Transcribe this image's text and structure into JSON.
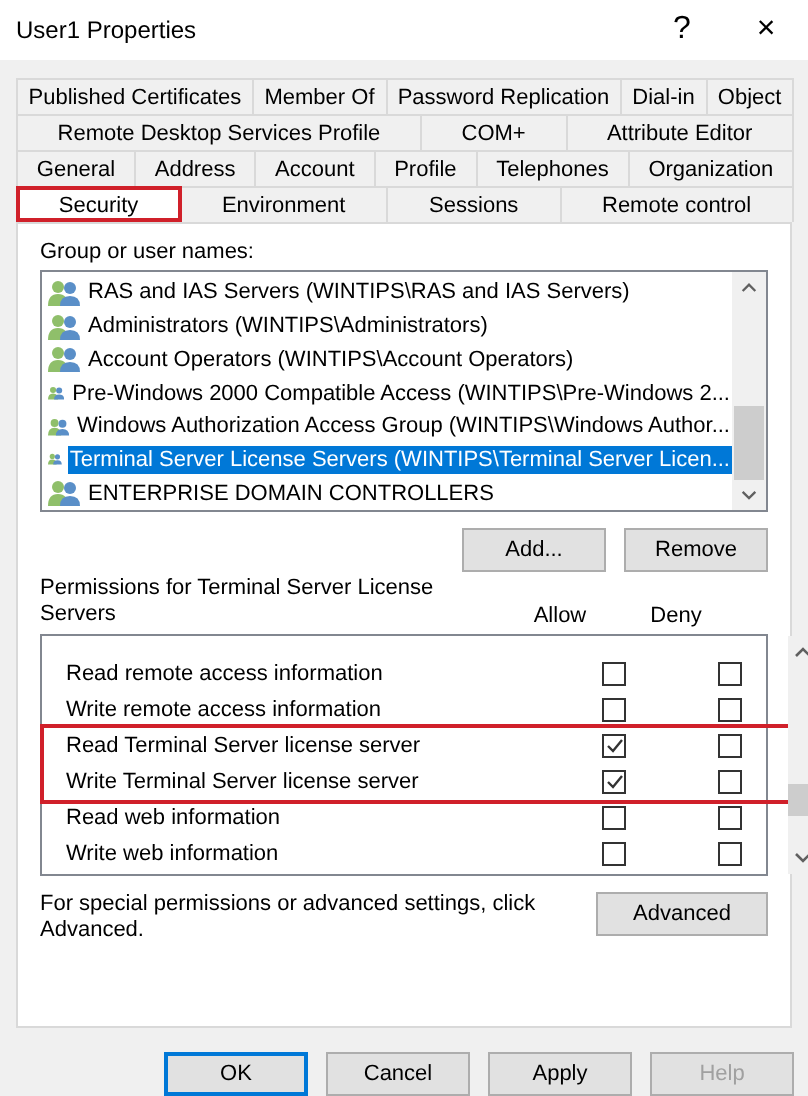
{
  "window": {
    "title": "User1 Properties",
    "help_glyph": "?",
    "close_glyph": "×"
  },
  "tab_rows": [
    [
      {
        "label": "Published Certificates",
        "selected": false,
        "highlighted": false
      },
      {
        "label": "Member Of",
        "selected": false,
        "highlighted": false
      },
      {
        "label": "Password Replication",
        "selected": false,
        "highlighted": false
      },
      {
        "label": "Dial-in",
        "selected": false,
        "highlighted": false
      },
      {
        "label": "Object",
        "selected": false,
        "highlighted": false
      }
    ],
    [
      {
        "label": "Remote Desktop Services Profile",
        "selected": false,
        "highlighted": false
      },
      {
        "label": "COM+",
        "selected": false,
        "highlighted": false
      },
      {
        "label": "Attribute Editor",
        "selected": false,
        "highlighted": false
      }
    ],
    [
      {
        "label": "General",
        "selected": false,
        "highlighted": false
      },
      {
        "label": "Address",
        "selected": false,
        "highlighted": false
      },
      {
        "label": "Account",
        "selected": false,
        "highlighted": false
      },
      {
        "label": "Profile",
        "selected": false,
        "highlighted": false
      },
      {
        "label": "Telephones",
        "selected": false,
        "highlighted": false
      },
      {
        "label": "Organization",
        "selected": false,
        "highlighted": false
      }
    ],
    [
      {
        "label": "Security",
        "selected": true,
        "highlighted": true
      },
      {
        "label": "Environment",
        "selected": false,
        "highlighted": false
      },
      {
        "label": "Sessions",
        "selected": false,
        "highlighted": false
      },
      {
        "label": "Remote control",
        "selected": false,
        "highlighted": false
      }
    ]
  ],
  "groups": {
    "label": "Group or user names:",
    "items": [
      {
        "name": "RAS and IAS Servers (WINTIPS\\RAS and IAS Servers)",
        "selected": false
      },
      {
        "name": "Administrators (WINTIPS\\Administrators)",
        "selected": false
      },
      {
        "name": "Account Operators (WINTIPS\\Account Operators)",
        "selected": false
      },
      {
        "name": "Pre-Windows 2000 Compatible Access (WINTIPS\\Pre-Windows 2...",
        "selected": false
      },
      {
        "name": "Windows Authorization Access Group (WINTIPS\\Windows Author...",
        "selected": false
      },
      {
        "name": "Terminal Server License Servers (WINTIPS\\Terminal Server Licen...",
        "selected": true
      },
      {
        "name": "ENTERPRISE DOMAIN CONTROLLERS",
        "selected": false
      }
    ],
    "buttons": [
      {
        "label": "Add..."
      },
      {
        "label": "Remove"
      }
    ]
  },
  "permissions": {
    "label": "Permissions for Terminal Server License Servers",
    "allow_heading": "Allow",
    "deny_heading": "Deny",
    "rows": [
      {
        "name": "Read remote access information",
        "allow": false,
        "deny": false,
        "highlighted": false
      },
      {
        "name": "Write remote access information",
        "allow": false,
        "deny": false,
        "highlighted": false
      },
      {
        "name": "Read Terminal Server license server",
        "allow": true,
        "deny": false,
        "highlighted": true
      },
      {
        "name": "Write Terminal Server license server",
        "allow": true,
        "deny": false,
        "highlighted": true
      },
      {
        "name": "Read web information",
        "allow": false,
        "deny": false,
        "highlighted": false
      },
      {
        "name": "Write web information",
        "allow": false,
        "deny": false,
        "highlighted": false
      }
    ]
  },
  "advanced": {
    "text": "For special permissions or advanced settings, click Advanced.",
    "button": "Advanced"
  },
  "footer_buttons": [
    {
      "label": "OK",
      "default": true,
      "disabled": false
    },
    {
      "label": "Cancel",
      "default": false,
      "disabled": false
    },
    {
      "label": "Apply",
      "default": false,
      "disabled": false
    },
    {
      "label": "Help",
      "default": false,
      "disabled": true
    }
  ]
}
